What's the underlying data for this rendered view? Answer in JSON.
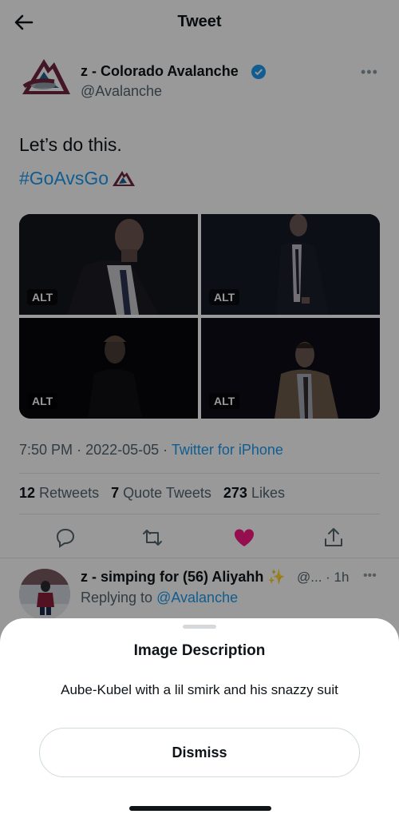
{
  "header": {
    "title": "Tweet"
  },
  "author": {
    "name": "z - Colorado Avalanche",
    "handle": "@Avalanche"
  },
  "tweet": {
    "text": "Let’s do this.",
    "hashtag": "#GoAvsGo",
    "media_badges": [
      "ALT",
      "ALT",
      "ALT",
      "ALT"
    ]
  },
  "meta": {
    "time": "7:50 PM",
    "date": "2022-05-05",
    "separator": "·",
    "source": "Twitter for iPhone"
  },
  "stats": {
    "retweets_count": "12",
    "retweets_label": "Retweets",
    "quotes_count": "7",
    "quotes_label": "Quote Tweets",
    "likes_count": "273",
    "likes_label": "Likes"
  },
  "actions": {
    "liked": true,
    "like_color": "#f91880"
  },
  "reply": {
    "name": "z - simping for (56) Aliyahh",
    "meta": "@... · 1h",
    "replying_prefix": "Replying to",
    "replying_to": "@Avalanche"
  },
  "sheet": {
    "title": "Image Description",
    "description": "Aube-Kubel with a lil smirk and his snazzy suit",
    "dismiss_label": "Dismiss"
  },
  "colors": {
    "accent": "#1d9bf0",
    "avalanche_burgundy": "#6f263d",
    "avalanche_blue": "#236192"
  }
}
